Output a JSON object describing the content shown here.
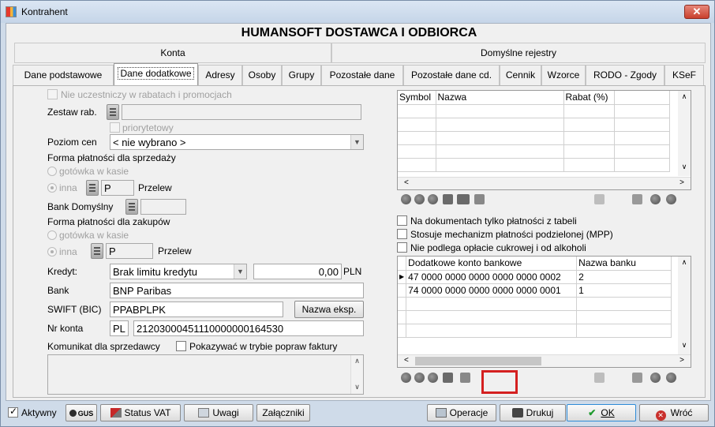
{
  "window": {
    "title": "Kontrahent",
    "close_symbol": "✕"
  },
  "header": {
    "name": "HUMANSOFT DOSTAWCA I ODBIORCA"
  },
  "group_tabs": [
    "Konta",
    "Domyślne rejestry"
  ],
  "tabs": [
    "Dane podstawowe",
    "Dane dodatkowe",
    "Adresy",
    "Osoby",
    "Grupy",
    "Pozostałe dane",
    "Pozostałe dane cd.",
    "Cennik",
    "Wzorce",
    "RODO - Zgody",
    "KSeF"
  ],
  "left": {
    "no_discount": "Nie uczestniczy w rabatach i promocjach",
    "discount_set_label": "Zestaw rab.",
    "priority": "priorytetowy",
    "price_level_label": "Poziom cen",
    "price_level_value": "< nie wybrano >",
    "sale_payment_label": "Forma płatności dla sprzedaży",
    "cash_label": "gotówka w kasie",
    "other_label": "inna",
    "sale_payment_code": "P",
    "sale_payment_name": "Przelew",
    "default_bank_label": "Bank Domyślny",
    "purchase_payment_label": "Forma płatności dla zakupów",
    "purchase_payment_code": "P",
    "purchase_payment_name": "Przelew",
    "credit_label": "Kredyt:",
    "credit_value": "Brak limitu kredytu",
    "credit_amount": "0,00",
    "currency": "PLN",
    "bank_label": "Bank",
    "bank_value": "BNP Paribas",
    "swift_label": "SWIFT (BIC)",
    "swift_value": "PPABPLPK",
    "export_name_button": "Nazwa eksp.",
    "account_label": "Nr konta",
    "account_country": "PL",
    "account_value": "21203000451110000000164530",
    "seller_msg_label": "Komunikat dla sprzedawcy",
    "show_in_correction": "Pokazywać w trybie popraw faktury"
  },
  "discount_grid": {
    "columns": [
      "Symbol",
      "Nazwa",
      "Rabat (%)"
    ]
  },
  "checks": {
    "only_table_payments": "Na dokumentach tylko płatności z tabeli",
    "split_payment": "Stosuje mechanizm płatności podzielonej (MPP)",
    "sugar_fee": "Nie podlega opłacie cukrowej i od alkoholi"
  },
  "bank_grid": {
    "columns": [
      "Dodatkowe konto bankowe",
      "Nazwa banku"
    ],
    "rows": [
      [
        "47 0000 0000 0000 0000 0000 0002",
        "2"
      ],
      [
        "74 0000 0000 0000 0000 0000 0001",
        "1"
      ]
    ]
  },
  "footer": {
    "active_label": "Aktywny",
    "gus_label": "GUS",
    "vat_status": "Status VAT",
    "notes": "Uwagi",
    "attachments": "Załączniki",
    "operations": "Operacje",
    "print": "Drukuj",
    "ok": "OK",
    "back": "Wróć"
  },
  "colors": {
    "accent_ok": "#1f9a2f",
    "back_red": "#c9302c",
    "highlight_box": "#d42020"
  }
}
